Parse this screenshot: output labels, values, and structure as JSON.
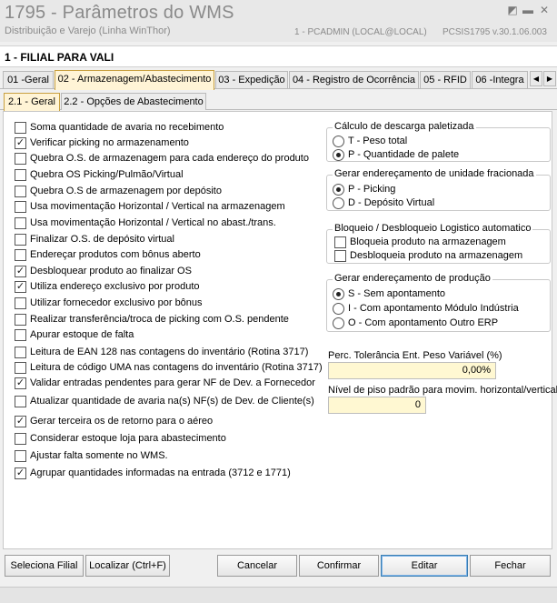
{
  "window": {
    "title": "1795 - Parâmetros do WMS",
    "subtitle": "Distribuição e Varejo (Linha WinThor)",
    "user": "1 - PCADMIN (LOCAL@LOCAL)",
    "version": "PCSIS1795  v.30.1.06.003"
  },
  "filial": {
    "label": "1 - FILIAL PARA VALI"
  },
  "tabs": [
    {
      "label": "01 -Geral"
    },
    {
      "label": "02 - Armazenagem/Abastecimento",
      "active": true
    },
    {
      "label": "03 - Expedição"
    },
    {
      "label": "04 - Registro de Ocorrência"
    },
    {
      "label": "05 - RFID"
    },
    {
      "label": "06 -Integra"
    }
  ],
  "subtabs": [
    {
      "label": "2.1 - Geral",
      "active": true
    },
    {
      "label": "2.2 - Opções de Abastecimento"
    }
  ],
  "checkboxes": [
    {
      "label": "Soma quantidade de avaria no recebimento",
      "checked": false
    },
    {
      "label": "Verificar picking no armazenamento",
      "checked": true
    },
    {
      "label": "Quebra O.S. de armazenagem para cada endereço do produto",
      "checked": false
    },
    {
      "label": "Quebra OS Picking/Pulmão/Virtual",
      "checked": false
    },
    {
      "label": "Quebra O.S de armazenagem por depósito",
      "checked": false
    },
    {
      "label": "Usa movimentação Horizontal / Vertical na armazenagem",
      "checked": false
    },
    {
      "label": "Usa movimentação Horizontal / Vertical no abast./trans.",
      "checked": false
    },
    {
      "label": "Finalizar O.S. de depósito virtual",
      "checked": false
    },
    {
      "label": "Endereçar produtos com bônus aberto",
      "checked": false
    },
    {
      "label": "Desbloquear produto ao finalizar OS",
      "checked": true
    },
    {
      "label": "Utiliza endereço exclusivo por produto",
      "checked": true
    },
    {
      "label": "Utilizar fornecedor exclusivo por bônus",
      "checked": false
    },
    {
      "label": "Realizar transferência/troca de picking com O.S. pendente",
      "checked": false
    },
    {
      "label": "Apurar estoque de falta",
      "checked": false
    },
    {
      "label": "Leitura de EAN 128 nas contagens do inventário (Rotina 3717)",
      "checked": false
    },
    {
      "label": "Leitura de código UMA nas contagens do inventário (Rotina 3717)",
      "checked": false
    },
    {
      "label": "Validar entradas pendentes para gerar NF de Dev. a Fornecedor",
      "checked": true
    },
    {
      "label": "Atualizar quantidade de avaria na(s) NF(s) de Dev. de Cliente(s)",
      "checked": false
    },
    {
      "label": "Gerar terceira os de retorno para o aéreo",
      "checked": true
    },
    {
      "label": "Considerar estoque loja para abastecimento",
      "checked": false
    },
    {
      "label": "Ajustar falta somente no WMS.",
      "checked": false
    },
    {
      "label": "Agrupar quantidades informadas na entrada (3712 e 1771)",
      "checked": true
    }
  ],
  "groups": {
    "descarga": {
      "title": "Cálculo de descarga paletizada",
      "options": [
        {
          "label": "T - Peso total",
          "selected": false
        },
        {
          "label": "P - Quantidade de palete",
          "selected": true
        }
      ]
    },
    "fracionada": {
      "title": "Gerar endereçamento de unidade fracionada",
      "options": [
        {
          "label": "P - Picking",
          "selected": true
        },
        {
          "label": "D - Depósito Virtual",
          "selected": false
        }
      ]
    },
    "bloqueio": {
      "title": "Bloqueio / Desbloqueio Logistico automatico",
      "options": [
        {
          "label": "Bloqueia produto na armazenagem",
          "checked": false
        },
        {
          "label": "Desbloqueia produto na armazenagem",
          "checked": false
        }
      ]
    },
    "producao": {
      "title": "Gerar endereçamento de produção",
      "options": [
        {
          "label": "S - Sem apontamento",
          "selected": true
        },
        {
          "label": "I - Com apontamento Módulo Indústria",
          "selected": false
        },
        {
          "label": "O - Com apontamento Outro ERP",
          "selected": false
        }
      ]
    }
  },
  "fields": {
    "tolerancia": {
      "label": "Perc. Tolerância Ent. Peso Variável (%)",
      "value": "0,00%"
    },
    "piso": {
      "label": "Nível de piso padrão para movim. horizontal/vertical",
      "value": "0"
    }
  },
  "buttons": {
    "seleciona": "Seleciona Filial",
    "localizar": "Localizar (Ctrl+F)",
    "cancelar": "Cancelar",
    "confirmar": "Confirmar",
    "editar": "Editar",
    "fechar": "Fechar"
  },
  "icons": {
    "restore": "restore-icon",
    "minimize": "minimize-icon",
    "close": "close-icon",
    "tab-left": "chevron-left-icon",
    "tab-right": "chevron-right-icon"
  }
}
